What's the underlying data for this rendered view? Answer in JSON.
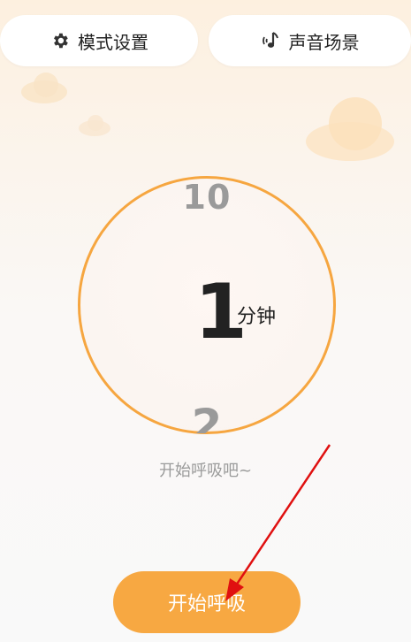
{
  "header": {
    "mode_label": "模式设置",
    "mode_icon": "gear-icon",
    "sound_label": "声音场景",
    "sound_icon": "music-note-icon"
  },
  "dial": {
    "tick_above": "10",
    "value": "1",
    "unit": "分钟",
    "tick_below": "2",
    "ring_color": "#f6a640"
  },
  "hint": "开始呼吸吧~",
  "start_button": {
    "label": "开始呼吸",
    "color": "#f7a842"
  },
  "annotation": {
    "arrow_color": "#e01010"
  }
}
